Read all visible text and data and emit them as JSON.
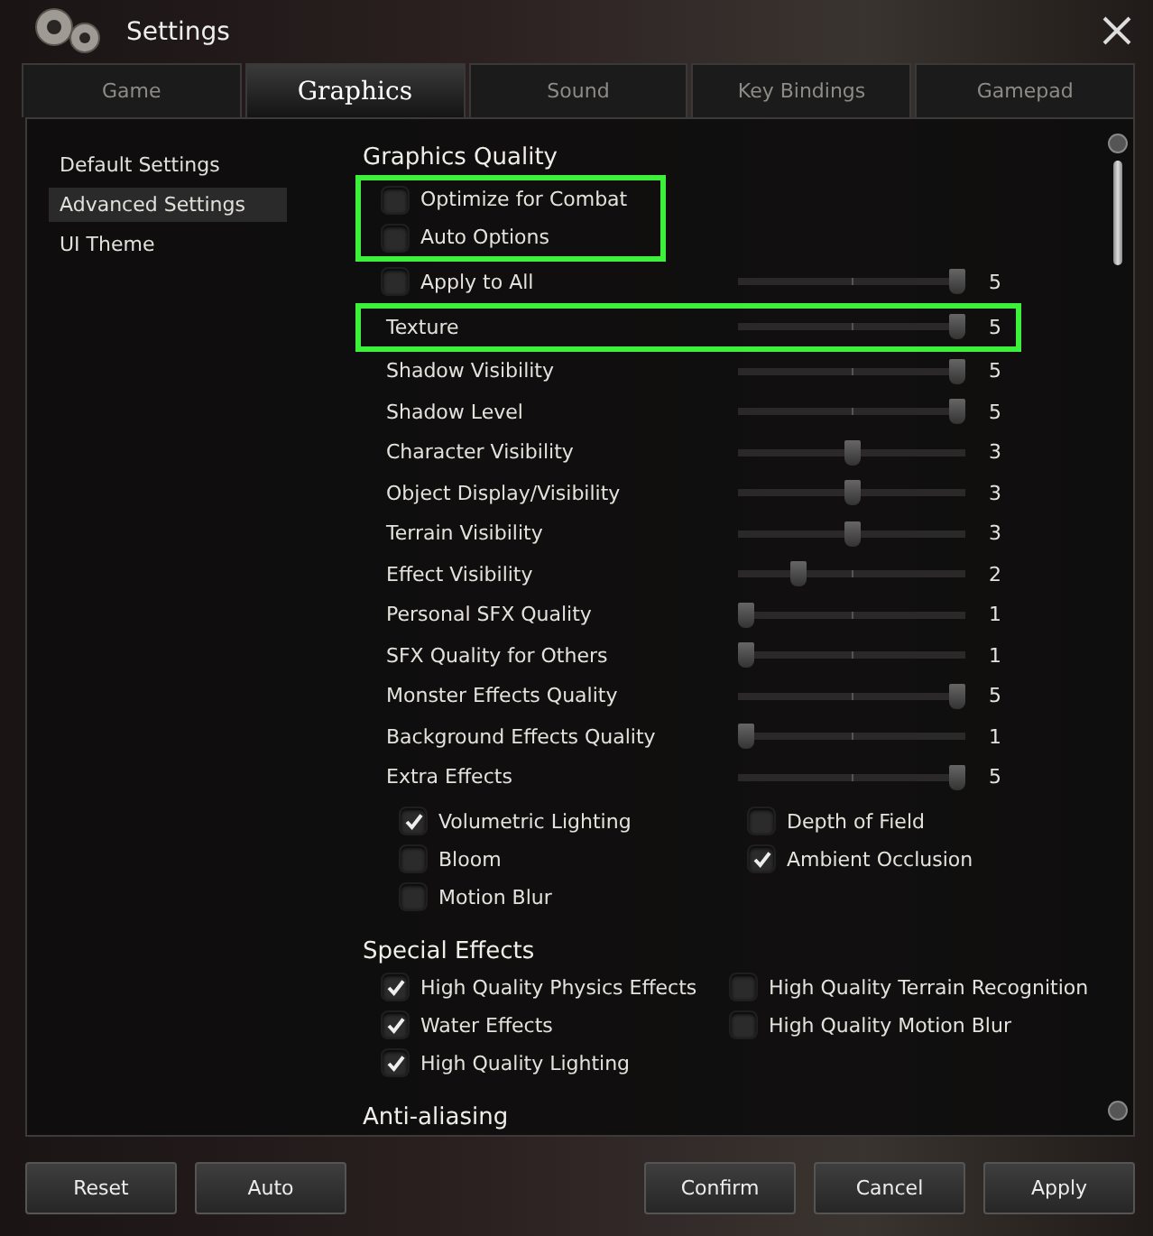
{
  "window": {
    "title": "Settings"
  },
  "tabs": [
    {
      "label": "Game",
      "selected": false
    },
    {
      "label": "Graphics",
      "selected": true
    },
    {
      "label": "Sound",
      "selected": false
    },
    {
      "label": "Key Bindings",
      "selected": false
    },
    {
      "label": "Gamepad",
      "selected": false
    }
  ],
  "sidebar": {
    "items": [
      {
        "label": "Default Settings",
        "selected": false
      },
      {
        "label": "Advanced Settings",
        "selected": true
      },
      {
        "label": "UI Theme",
        "selected": false
      }
    ]
  },
  "graphics_quality": {
    "title": "Graphics Quality",
    "rows": [
      {
        "kind": "checkbox",
        "label": "Optimize for Combat",
        "checked": false,
        "highlighted": true
      },
      {
        "kind": "checkbox",
        "label": "Auto Options",
        "checked": false,
        "highlighted": true
      },
      {
        "kind": "checkslider",
        "label": "Apply to All",
        "checked": false,
        "level": 1,
        "reading": "5",
        "highlighted": false
      },
      {
        "kind": "slider",
        "label": "Texture",
        "level": 1,
        "reading": "5",
        "highlighted": true
      },
      {
        "kind": "slider",
        "label": "Shadow Visibility",
        "level": 1,
        "reading": "5",
        "highlighted": false
      },
      {
        "kind": "slider",
        "label": "Shadow Level",
        "level": 1,
        "reading": "5",
        "highlighted": false
      },
      {
        "kind": "slider",
        "label": "Character Visibility",
        "level": 0.5,
        "reading": "3",
        "highlighted": false
      },
      {
        "kind": "slider",
        "label": "Object Display/Visibility",
        "level": 0.5,
        "reading": "3",
        "highlighted": false
      },
      {
        "kind": "slider",
        "label": "Terrain Visibility",
        "level": 0.5,
        "reading": "3",
        "highlighted": false
      },
      {
        "kind": "slider",
        "label": "Effect Visibility",
        "level": 0.25,
        "reading": "2",
        "highlighted": false
      },
      {
        "kind": "slider",
        "label": "Personal SFX Quality",
        "level": 0,
        "reading": "1",
        "highlighted": false
      },
      {
        "kind": "slider",
        "label": "SFX Quality for Others",
        "level": 0,
        "reading": "1",
        "highlighted": false
      },
      {
        "kind": "slider",
        "label": "Monster Effects Quality",
        "level": 1,
        "reading": "5",
        "highlighted": false
      },
      {
        "kind": "slider",
        "label": "Background Effects Quality",
        "level": 0,
        "reading": "1",
        "highlighted": false
      },
      {
        "kind": "slider",
        "label": "Extra Effects",
        "level": 1,
        "reading": "5",
        "highlighted": false
      }
    ],
    "extra_options": [
      {
        "label": "Volumetric Lighting",
        "checked": true
      },
      {
        "label": "Depth of Field",
        "checked": false
      },
      {
        "label": "Bloom",
        "checked": false
      },
      {
        "label": "Ambient Occlusion",
        "checked": true
      },
      {
        "label": "Motion Blur",
        "checked": false
      }
    ]
  },
  "special_effects": {
    "title": "Special Effects",
    "options": [
      {
        "label": "High Quality Physics Effects",
        "checked": true
      },
      {
        "label": "High Quality Terrain Recognition",
        "checked": false
      },
      {
        "label": "Water Effects",
        "checked": true
      },
      {
        "label": "High Quality Motion Blur",
        "checked": false
      },
      {
        "label": "High Quality Lighting",
        "checked": true
      }
    ]
  },
  "anti_aliasing": {
    "title": "Anti-aliasing"
  },
  "footer_buttons_left": [
    "Reset",
    "Auto"
  ],
  "footer_buttons_right": [
    "Confirm",
    "Cancel",
    "Apply"
  ]
}
